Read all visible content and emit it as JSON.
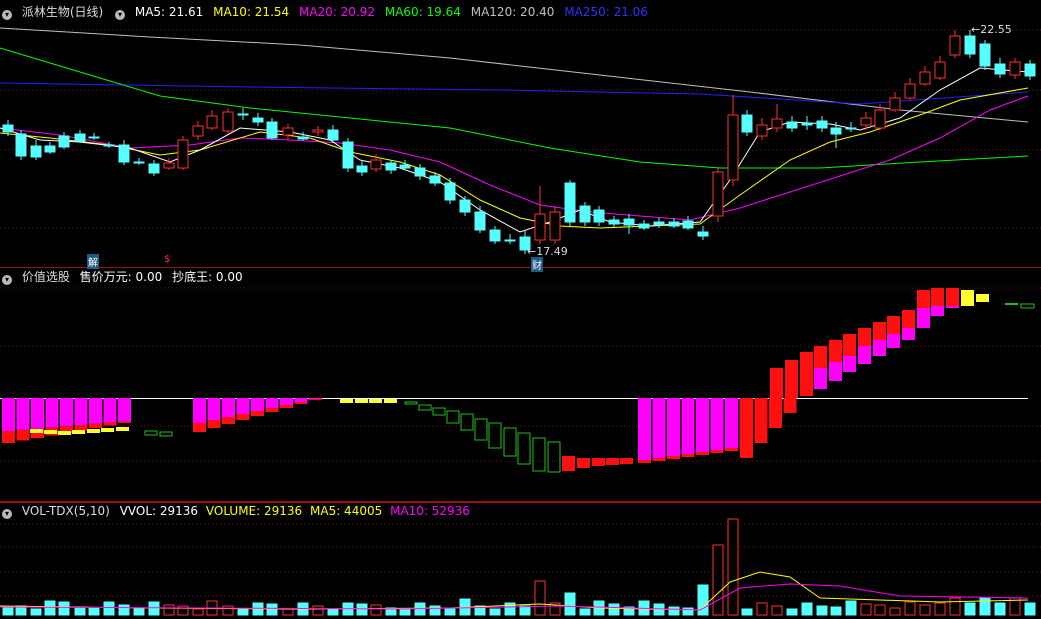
{
  "price_pane": {
    "stock_name": "派林生物(日线)",
    "ma5": "MA5: 21.61",
    "ma10": "MA10: 21.54",
    "ma20": "MA20: 20.92",
    "ma60": "MA60: 19.64",
    "ma120": "MA120: 20.40",
    "ma250": "MA250: 21.06",
    "high_marker": "22.55",
    "low_marker": "17.49",
    "event_jie": "解",
    "event_s": "$",
    "event_cai": "财",
    "colors": {
      "ma5": "#ffffff",
      "ma10": "#ffff00",
      "ma20": "#ff00ff",
      "ma60": "#00ff00",
      "ma120": "#c0c0c0",
      "ma250": "#2020ff",
      "up": "#ff3030",
      "down": "#55ffff"
    }
  },
  "indicator_pane": {
    "name": "价值选股",
    "sell_label": "售价万元: 0.00",
    "bottom_label": "抄底王: 0.00"
  },
  "volume_pane": {
    "name": "VOL-TDX(5,10)",
    "vvol": "VVOL: 29136",
    "volume": "VOLUME: 29136",
    "ma5": "MA5: 44005",
    "ma10": "MA10: 52936"
  }
}
